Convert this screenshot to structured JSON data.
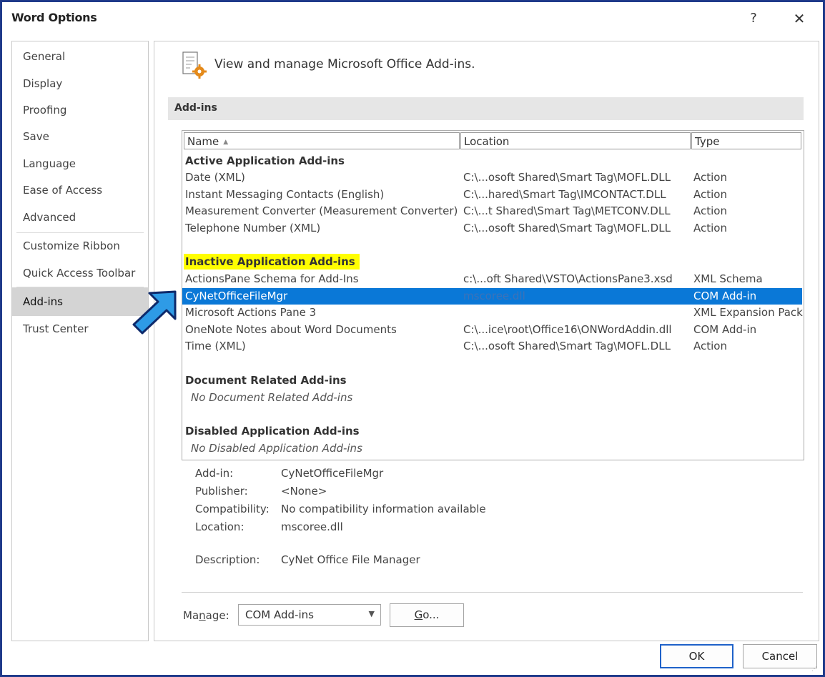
{
  "window": {
    "title": "Word Options",
    "help": "?",
    "close": "✕"
  },
  "sidebar": {
    "items": [
      {
        "label": "General"
      },
      {
        "label": "Display"
      },
      {
        "label": "Proofing"
      },
      {
        "label": "Save"
      },
      {
        "label": "Language"
      },
      {
        "label": "Ease of Access"
      },
      {
        "label": "Advanced"
      },
      {
        "label": "Customize Ribbon"
      },
      {
        "label": "Quick Access Toolbar"
      },
      {
        "label": "Add-ins"
      },
      {
        "label": "Trust Center"
      }
    ],
    "selected": "Add-ins"
  },
  "main": {
    "header": "View and manage Microsoft Office Add-ins.",
    "section_title": "Add-ins",
    "columns": {
      "name": "Name",
      "location": "Location",
      "type": "Type"
    },
    "groups": {
      "active": "Active Application Add-ins",
      "inactive": "Inactive Application Add-ins",
      "document": "Document Related Add-ins",
      "disabled": "Disabled Application Add-ins"
    },
    "active_rows": [
      {
        "name": "Date (XML)",
        "location": "C:\\...osoft Shared\\Smart Tag\\MOFL.DLL",
        "type": "Action"
      },
      {
        "name": "Instant Messaging Contacts (English)",
        "location": "C:\\...hared\\Smart Tag\\IMCONTACT.DLL",
        "type": "Action"
      },
      {
        "name": "Measurement Converter (Measurement Converter)",
        "location": "C:\\...t Shared\\Smart Tag\\METCONV.DLL",
        "type": "Action"
      },
      {
        "name": "Telephone Number (XML)",
        "location": "C:\\...osoft Shared\\Smart Tag\\MOFL.DLL",
        "type": "Action"
      }
    ],
    "inactive_rows": [
      {
        "name": "ActionsPane Schema for Add-Ins",
        "location": "c:\\...oft Shared\\VSTO\\ActionsPane3.xsd",
        "type": "XML Schema"
      },
      {
        "name": "CyNetOfficeFileMgr",
        "location": "mscoree.dll",
        "type": "COM Add-in"
      },
      {
        "name": "Microsoft Actions Pane 3",
        "location": "",
        "type": "XML Expansion Pack"
      },
      {
        "name": "OneNote Notes about Word Documents",
        "location": "C:\\...ice\\root\\Office16\\ONWordAddin.dll",
        "type": "COM Add-in"
      },
      {
        "name": "Time (XML)",
        "location": "C:\\...osoft Shared\\Smart Tag\\MOFL.DLL",
        "type": "Action"
      }
    ],
    "document_empty": "No Document Related Add-ins",
    "disabled_empty": "No Disabled Application Add-ins",
    "details": {
      "addin_label": "Add-in:",
      "addin": "CyNetOfficeFileMgr",
      "publisher_label": "Publisher:",
      "publisher": "<None>",
      "compat_label": "Compatibility:",
      "compat": "No compatibility information available",
      "location_label": "Location:",
      "location": "mscoree.dll",
      "description_label": "Description:",
      "description": "CyNet Office File Manager"
    },
    "manage": {
      "label_pre": "Ma",
      "label_u": "n",
      "label_post": "age:",
      "value": "COM Add-ins",
      "go_u": "G",
      "go_post": "o..."
    }
  },
  "footer": {
    "ok": "OK",
    "cancel": "Cancel"
  },
  "colors": {
    "selection": "#0a78d7",
    "highlight": "#fffe00",
    "frame": "#1f3a8a",
    "arrow": "#2e9be6"
  }
}
